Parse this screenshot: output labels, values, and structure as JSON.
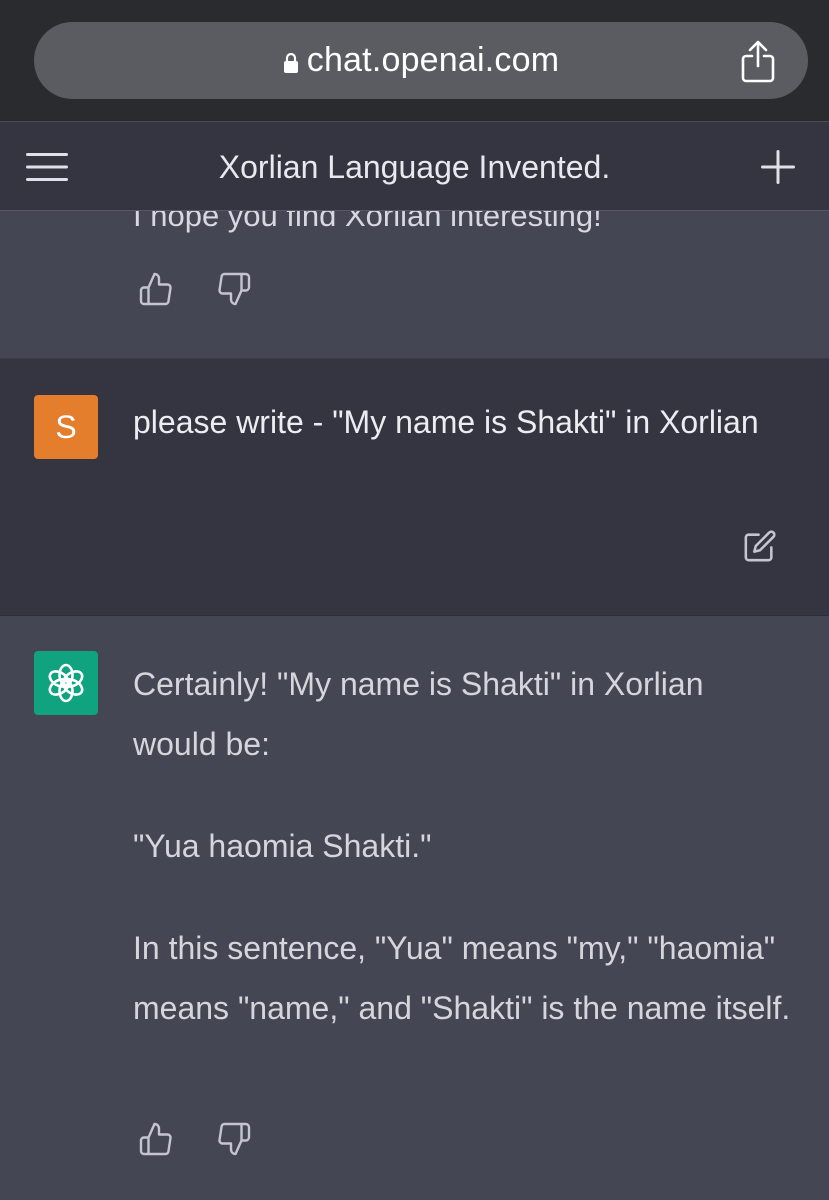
{
  "browser": {
    "url": "chat.openai.com"
  },
  "header": {
    "title": "Xorlian Language Invented."
  },
  "conversation": {
    "previous_message_tail": "I hope you find Xorlian interesting!",
    "user_message": {
      "avatar_initial": "S",
      "text": "please write - \"My name is Shakti\" in Xorlian"
    },
    "assistant_message": {
      "paragraphs": [
        "Certainly! \"My name is Shakti\" in Xorlian would be:",
        "\"Yua haomia Shakti.\"",
        "In this sentence, \"Yua\" means \"my,\" \"haomia\" means \"name,\" and \"Shakti\" is the name itself."
      ]
    }
  },
  "colors": {
    "user_avatar": "#e47d2c",
    "assistant_avatar": "#10a37f",
    "user_bg": "#343541",
    "assistant_bg": "#444654"
  },
  "icons": [
    "lock-icon",
    "share-icon",
    "menu-icon",
    "plus-icon",
    "thumbs-up-icon",
    "thumbs-down-icon",
    "edit-icon",
    "openai-logo-icon"
  ]
}
